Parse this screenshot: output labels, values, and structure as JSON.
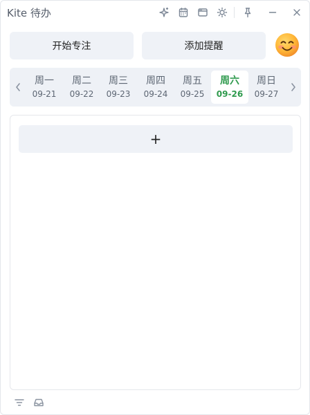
{
  "window": {
    "title": "Kite 待办",
    "title_icons": [
      "sparkle-icon",
      "calendar-icon",
      "window-icon",
      "sun-icon",
      "pin-icon",
      "minimize-icon",
      "close-icon"
    ]
  },
  "actions": {
    "focus_label": "开始专注",
    "remind_label": "添加提醒",
    "avatar": "smiling-face-emoji"
  },
  "days": [
    {
      "name": "周一",
      "date": "09-21",
      "active": false
    },
    {
      "name": "周二",
      "date": "09-22",
      "active": false
    },
    {
      "name": "周三",
      "date": "09-23",
      "active": false
    },
    {
      "name": "周四",
      "date": "09-24",
      "active": false
    },
    {
      "name": "周五",
      "date": "09-25",
      "active": false
    },
    {
      "name": "周六",
      "date": "09-26",
      "active": true
    },
    {
      "name": "周日",
      "date": "09-27",
      "active": false
    }
  ],
  "tasks": {
    "add_label": "+"
  },
  "colors": {
    "accent": "#2f9a4d",
    "button_bg": "#eff2f7",
    "strip_bg": "#eef1f6"
  },
  "bottom_icons": [
    "filter-icon",
    "inbox-icon"
  ]
}
